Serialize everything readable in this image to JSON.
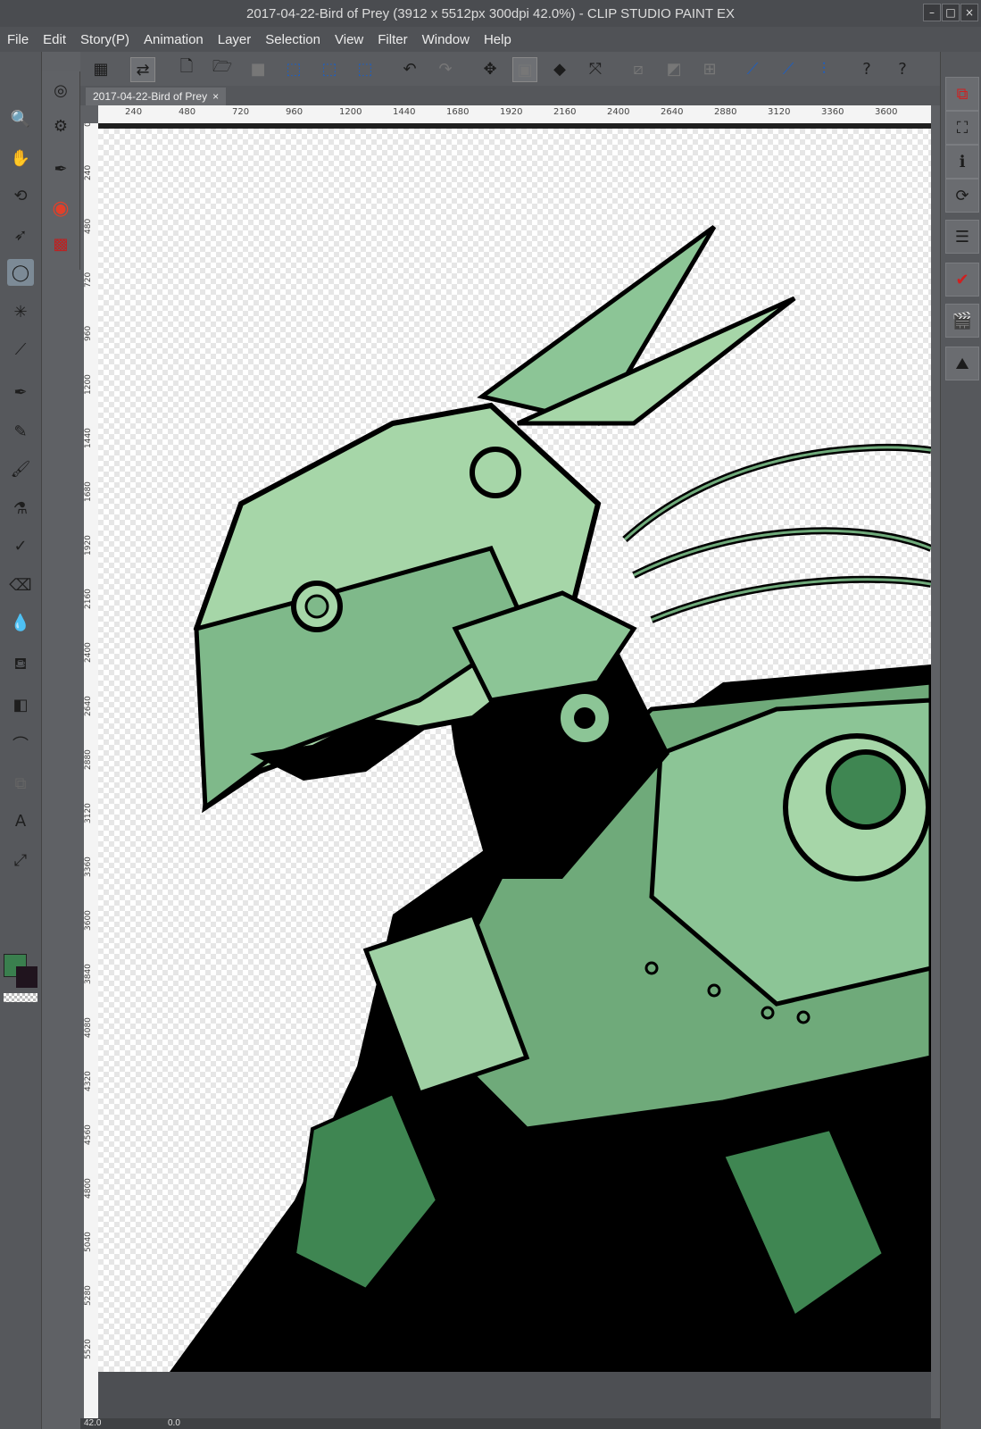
{
  "window": {
    "title": "2017-04-22-Bird of Prey (3912 x 5512px 300dpi 42.0%)  - CLIP STUDIO PAINT EX"
  },
  "menu": [
    "File",
    "Edit",
    "Story(P)",
    "Animation",
    "Layer",
    "Selection",
    "View",
    "Filter",
    "Window",
    "Help"
  ],
  "document_tab": {
    "name": "2017-04-22-Bird of Prey",
    "close": "×"
  },
  "ruler": {
    "h_labels": [
      "240",
      "480",
      "720",
      "960",
      "1200",
      "1440",
      "1680",
      "1920",
      "2160",
      "2400",
      "2640",
      "2880",
      "3120",
      "3360",
      "3600"
    ],
    "v_labels": [
      "0",
      "240",
      "480",
      "720",
      "960",
      "1200",
      "1440",
      "1680",
      "1920",
      "2160",
      "2400",
      "2640",
      "2880",
      "3120",
      "3360",
      "3600",
      "3840",
      "4080",
      "4320",
      "4560",
      "4800",
      "5040",
      "5280",
      "5520"
    ]
  },
  "status": {
    "zoom": "42.0",
    "rotation": "0.0"
  },
  "colors": {
    "main": "#3a7f4e",
    "sub": "#20141e",
    "accent_green": "#a8d8a8",
    "mid_green": "#5f9f6e"
  },
  "icons": {
    "command_bar": [
      "app-grid-icon",
      "canvas-toggle-icon",
      "new-file-icon",
      "open-file-icon",
      "save-icon",
      "select-all-icon",
      "select-layer-icon",
      "select-icon",
      "undo-icon",
      "redo-icon",
      "transform-icon",
      "clear-icon",
      "fill-icon",
      "fit-icon",
      "ruler-off-icon",
      "ruler-snap-icon",
      "grid-icon",
      "snap-ruler-icon",
      "snap-special-icon",
      "snap-grid-icon",
      "help-icon",
      "help2-icon"
    ],
    "left_tools": [
      "zoom-icon",
      "hand-icon",
      "rotate-icon",
      "move-icon",
      "lasso-icon",
      "magic-wand-icon",
      "eyedropper-icon",
      "pen-icon",
      "pencil-icon",
      "brush-icon",
      "airbrush-icon",
      "decoration-icon",
      "eraser-icon",
      "blend-icon",
      "fill-bucket-icon",
      "gradient-icon",
      "figure-icon",
      "frame-icon",
      "text-icon",
      "balloon-icon"
    ],
    "right_tools": [
      "layer-property-icon",
      "tool-property-icon",
      "info-icon",
      "color-sync-icon",
      "layer-icon",
      "check-icon",
      "animation-icon",
      "navigator-icon"
    ]
  }
}
